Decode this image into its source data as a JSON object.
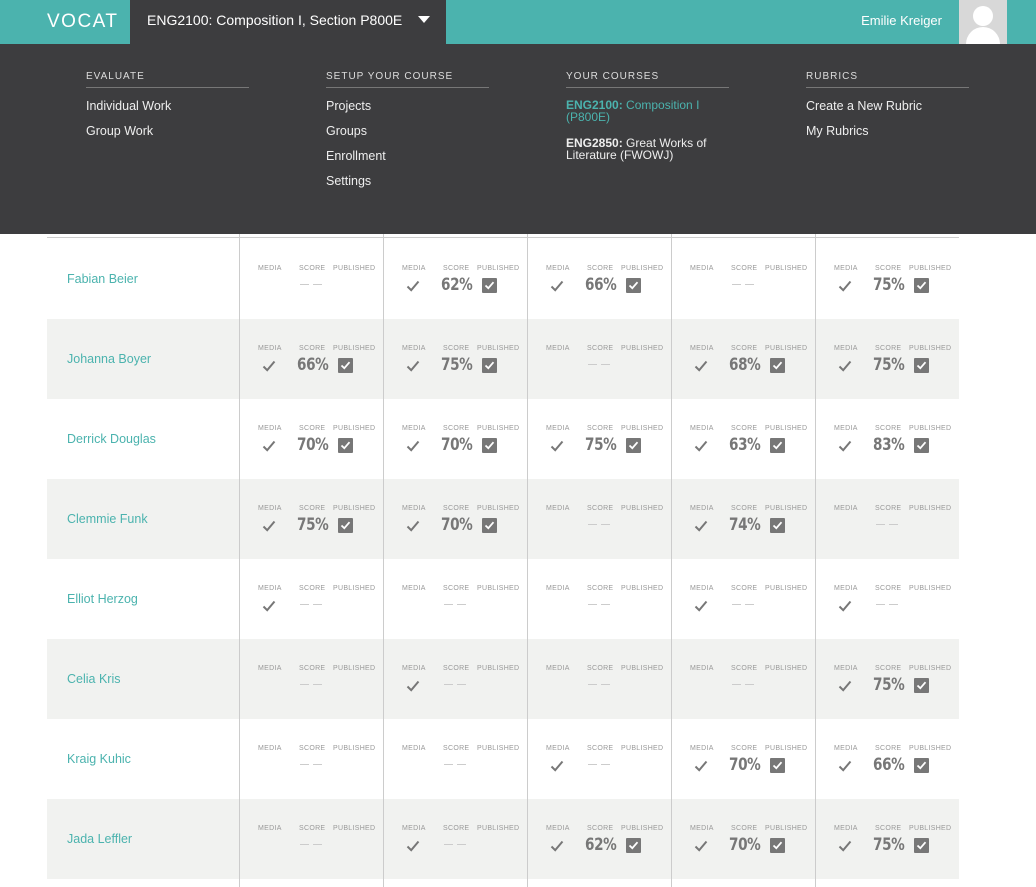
{
  "brand": {
    "logo": "VOCAT"
  },
  "header": {
    "course_selector": "ENG2100: Composition I, Section P800E",
    "user_name": "Emilie Kreiger"
  },
  "menu": {
    "evaluate": {
      "heading": "EVALUATE",
      "items": [
        "Individual Work",
        "Group Work"
      ]
    },
    "setup": {
      "heading": "SETUP YOUR COURSE",
      "items": [
        "Projects",
        "Groups",
        "Enrollment",
        "Settings"
      ]
    },
    "courses": {
      "heading": "YOUR COURSES",
      "items": [
        {
          "code": "ENG2100:",
          "name": " Composition I (P800E)",
          "active": true
        },
        {
          "code": "ENG2850:",
          "name": " Great Works of Literature (FWOWJ)",
          "active": false
        }
      ]
    },
    "rubrics": {
      "heading": "RUBRICS",
      "items": [
        "Create a New Rubric",
        "My Rubrics"
      ]
    }
  },
  "grid": {
    "labels": {
      "media": "MEDIA",
      "score": "SCORE",
      "published": "PUBLISHED"
    },
    "colors": {
      "accent": "#4bb3ae",
      "dark": "#3d3d3f",
      "alt_row": "#f1f2f0"
    },
    "rows": [
      {
        "student": "Fabian Beier",
        "cells": [
          {
            "media": false,
            "score": null,
            "published": false
          },
          {
            "media": true,
            "score": "62%",
            "published": true
          },
          {
            "media": true,
            "score": "66%",
            "published": true
          },
          {
            "media": false,
            "score": null,
            "published": false
          },
          {
            "media": true,
            "score": "75%",
            "published": true
          }
        ]
      },
      {
        "student": "Johanna Boyer",
        "cells": [
          {
            "media": true,
            "score": "66%",
            "published": true
          },
          {
            "media": true,
            "score": "75%",
            "published": true
          },
          {
            "media": false,
            "score": null,
            "published": false
          },
          {
            "media": true,
            "score": "68%",
            "published": true
          },
          {
            "media": true,
            "score": "75%",
            "published": true
          }
        ]
      },
      {
        "student": "Derrick Douglas",
        "cells": [
          {
            "media": true,
            "score": "70%",
            "published": true
          },
          {
            "media": true,
            "score": "70%",
            "published": true
          },
          {
            "media": true,
            "score": "75%",
            "published": true
          },
          {
            "media": true,
            "score": "63%",
            "published": true
          },
          {
            "media": true,
            "score": "83%",
            "published": true
          }
        ]
      },
      {
        "student": "Clemmie Funk",
        "cells": [
          {
            "media": true,
            "score": "75%",
            "published": true
          },
          {
            "media": true,
            "score": "70%",
            "published": true
          },
          {
            "media": false,
            "score": null,
            "published": false
          },
          {
            "media": true,
            "score": "74%",
            "published": true
          },
          {
            "media": false,
            "score": null,
            "published": false
          }
        ]
      },
      {
        "student": "Elliot Herzog",
        "cells": [
          {
            "media": true,
            "score": null,
            "published": false
          },
          {
            "media": false,
            "score": null,
            "published": false
          },
          {
            "media": false,
            "score": null,
            "published": false
          },
          {
            "media": true,
            "score": null,
            "published": false
          },
          {
            "media": true,
            "score": null,
            "published": false
          }
        ]
      },
      {
        "student": "Celia Kris",
        "cells": [
          {
            "media": false,
            "score": null,
            "published": false
          },
          {
            "media": true,
            "score": null,
            "published": false
          },
          {
            "media": false,
            "score": null,
            "published": false
          },
          {
            "media": false,
            "score": null,
            "published": false
          },
          {
            "media": true,
            "score": "75%",
            "published": true
          }
        ]
      },
      {
        "student": "Kraig Kuhic",
        "cells": [
          {
            "media": false,
            "score": null,
            "published": false
          },
          {
            "media": false,
            "score": null,
            "published": false
          },
          {
            "media": true,
            "score": null,
            "published": false
          },
          {
            "media": true,
            "score": "70%",
            "published": true
          },
          {
            "media": true,
            "score": "66%",
            "published": true
          }
        ]
      },
      {
        "student": "Jada Leffler",
        "cells": [
          {
            "media": false,
            "score": null,
            "published": false
          },
          {
            "media": true,
            "score": null,
            "published": false
          },
          {
            "media": true,
            "score": "62%",
            "published": true
          },
          {
            "media": true,
            "score": "70%",
            "published": true
          },
          {
            "media": true,
            "score": "75%",
            "published": true
          }
        ]
      }
    ]
  }
}
